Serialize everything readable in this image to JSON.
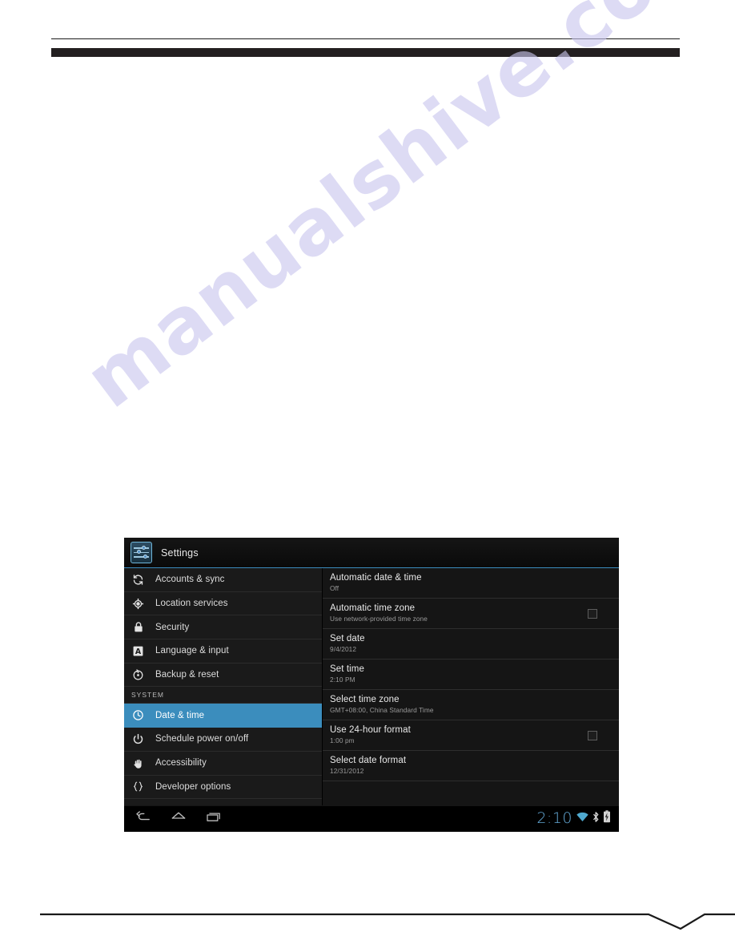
{
  "watermark": {
    "text": "manualshive.com",
    "color": "#c9c6ee"
  },
  "theme": {
    "accent": "#3b8dbd",
    "clock_color": "#63a8d6",
    "screen_bg": "#000000",
    "sidebar_bg": "#1a1a1a",
    "pane_bg": "#151515"
  },
  "screenshot": {
    "actionbar": {
      "app_icon": "settings-sliders-icon",
      "title": "Settings"
    },
    "sidebar": {
      "items": [
        {
          "label": "Accounts & sync",
          "icon": "sync-icon",
          "selected": false,
          "type": "item"
        },
        {
          "label": "Location services",
          "icon": "location-icon",
          "selected": false,
          "type": "item"
        },
        {
          "label": "Security",
          "icon": "lock-icon",
          "selected": false,
          "type": "item"
        },
        {
          "label": "Language & input",
          "icon": "language-a-icon",
          "selected": false,
          "type": "item"
        },
        {
          "label": "Backup & reset",
          "icon": "backup-icon",
          "selected": false,
          "type": "item"
        },
        {
          "label": "SYSTEM",
          "icon": "",
          "selected": false,
          "type": "header"
        },
        {
          "label": "Date & time",
          "icon": "clock-icon",
          "selected": true,
          "type": "item"
        },
        {
          "label": "Schedule power on/off",
          "icon": "power-icon",
          "selected": false,
          "type": "item"
        },
        {
          "label": "Accessibility",
          "icon": "hand-icon",
          "selected": false,
          "type": "item"
        },
        {
          "label": "Developer options",
          "icon": "braces-icon",
          "selected": false,
          "type": "item"
        }
      ]
    },
    "pane": {
      "prefs": [
        {
          "title": "Automatic date & time",
          "sub": "Off",
          "checkbox": false,
          "checked": false
        },
        {
          "title": "Automatic time zone",
          "sub": "Use network-provided time zone",
          "checkbox": true,
          "checked": false
        },
        {
          "title": "Set date",
          "sub": "9/4/2012",
          "checkbox": false,
          "checked": false
        },
        {
          "title": "Set time",
          "sub": "2:10 PM",
          "checkbox": false,
          "checked": false
        },
        {
          "title": "Select time zone",
          "sub": "GMT+08:00, China Standard Time",
          "checkbox": false,
          "checked": false
        },
        {
          "title": "Use 24-hour format",
          "sub": "1:00 pm",
          "checkbox": true,
          "checked": false
        },
        {
          "title": "Select date format",
          "sub": "12/31/2012",
          "checkbox": false,
          "checked": false
        }
      ]
    },
    "navbar": {
      "back_icon": "back-arrow-icon",
      "home_icon": "home-icon",
      "recents_icon": "recent-apps-icon",
      "clock": "2:10",
      "status_icons": [
        "wifi-icon",
        "bluetooth-icon",
        "battery-icon"
      ]
    }
  }
}
